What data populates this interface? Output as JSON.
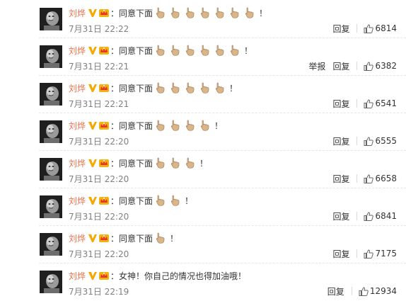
{
  "comments": [
    {
      "username": "刘烨",
      "text": "同意下面",
      "emoji_count": 7,
      "emoji_name": "point-down-icon",
      "suffix": "！",
      "time": "7月31日 22:22",
      "report": "",
      "reply": "回复",
      "likes": "6814"
    },
    {
      "username": "刘烨",
      "text": "同意下面",
      "emoji_count": 6,
      "emoji_name": "point-down-icon",
      "suffix": "！",
      "time": "7月31日 22:21",
      "report": "举报",
      "reply": "回复",
      "likes": "6382"
    },
    {
      "username": "刘烨",
      "text": "同意下面",
      "emoji_count": 5,
      "emoji_name": "point-down-icon",
      "suffix": "！",
      "time": "7月31日 22:21",
      "report": "",
      "reply": "回复",
      "likes": "6541"
    },
    {
      "username": "刘烨",
      "text": "同意下面",
      "emoji_count": 4,
      "emoji_name": "point-down-icon",
      "suffix": "！",
      "time": "7月31日 22:20",
      "report": "",
      "reply": "回复",
      "likes": "6555"
    },
    {
      "username": "刘烨",
      "text": "同意下面",
      "emoji_count": 3,
      "emoji_name": "point-down-icon",
      "suffix": "！",
      "time": "7月31日 22:20",
      "report": "",
      "reply": "回复",
      "likes": "6658"
    },
    {
      "username": "刘烨",
      "text": "同意下面",
      "emoji_count": 2,
      "emoji_name": "point-down-icon",
      "suffix": "！",
      "time": "7月31日 22:20",
      "report": "",
      "reply": "回复",
      "likes": "6841"
    },
    {
      "username": "刘烨",
      "text": "同意下面",
      "emoji_count": 1,
      "emoji_name": "point-down-icon",
      "suffix": "！",
      "time": "7月31日 22:20",
      "report": "",
      "reply": "回复",
      "likes": "7175"
    },
    {
      "username": "刘烨",
      "text": "女神！你自己的情况也得加油哦！",
      "emoji_count": 0,
      "emoji_name": "point-down-icon",
      "suffix": "",
      "time": "7月31日 22:19",
      "report": "",
      "reply": "回复",
      "likes": "12934"
    }
  ],
  "colors": {
    "username": "#eb7350",
    "verified": "#f7a800",
    "text": "#333333",
    "time": "#808080"
  },
  "icons": {
    "verified": "verified-v-icon",
    "member": "member-crown-icon",
    "like": "thumbs-up-icon",
    "avatar": "avatar-photo"
  }
}
